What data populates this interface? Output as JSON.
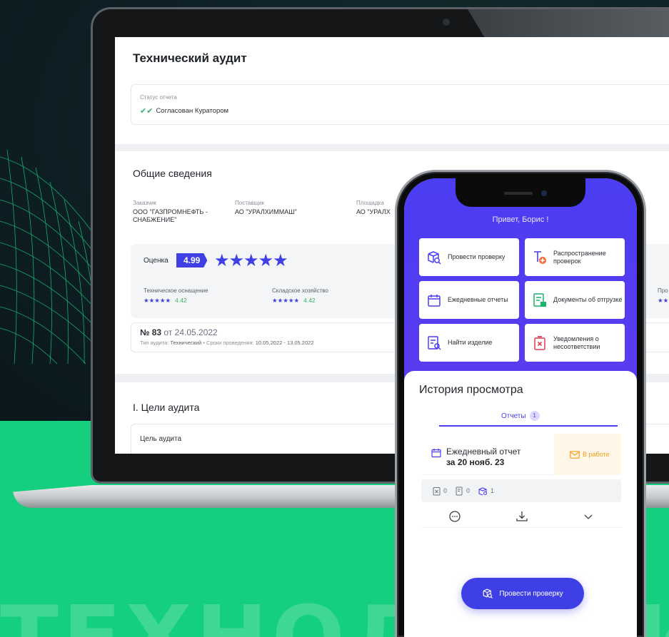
{
  "laptop": {
    "page_title": "Технический аудит",
    "status": {
      "label": "Статус отчета",
      "value": "Согласован Куратором"
    },
    "general": {
      "title": "Общие сведения",
      "customer": {
        "label": "Заказчик",
        "value": "ООО \"ГАЗПРОМНЕФТЬ - СНАБЖЕНИЕ\""
      },
      "supplier": {
        "label": "Поставщик",
        "value": "АО \"УРАЛХИММАШ\""
      },
      "site": {
        "label": "Площадка",
        "value": "АО \"УРАЛХ"
      }
    },
    "rating": {
      "label": "Оценка",
      "score": "4.99",
      "stars": "★★★★★",
      "sub": [
        {
          "label": "Техническое оснащение",
          "stars": "★★★★★",
          "value": "4.42"
        },
        {
          "label": "Складское хозяйство",
          "stars": "★★★★★",
          "value": "4.42"
        },
        {
          "label": "Про",
          "stars": "★★",
          "value": ""
        }
      ]
    },
    "audit": {
      "number": "№ 83",
      "date": "от 24.05.2022",
      "type_label": "Тип аудита:",
      "type_value": "Технический",
      "period_label": "• Сроки проведения:",
      "period_value": "10.05.2022 - 13.05.2022"
    },
    "goals": {
      "title": "I. Цели аудита",
      "goal_label": "Цель аудита"
    }
  },
  "phone": {
    "greeting": "Привет, Борис !",
    "tiles": [
      {
        "label": "Провести проверку",
        "icon": "box-search-icon"
      },
      {
        "label": "Распространение проверок",
        "icon": "document-plus-icon"
      },
      {
        "label": "Ежедневные отчеты",
        "icon": "calendar-icon"
      },
      {
        "label": "Документы об отгрузке",
        "icon": "shipping-doc-icon"
      },
      {
        "label": "Найти изделие",
        "icon": "find-doc-icon"
      },
      {
        "label": "Уведомления о несоответствии",
        "icon": "nonconformity-icon"
      }
    ],
    "history": {
      "title": "История просмотра",
      "tab_label": "Отчеты",
      "tab_count": "1",
      "report": {
        "type": "Ежедневный отчет",
        "date": "за 20 нояб. 23",
        "status": "В работе"
      },
      "counts": [
        "0",
        "0",
        "1"
      ]
    },
    "fab_label": "Провести проверку"
  },
  "background_text": "ТЕХНОЛОГИИ",
  "colors": {
    "accent": "#3f3fe6",
    "phone_header": "#4a3df2",
    "green": "#14cf7d",
    "status_ok": "#35b36b",
    "status_in_progress": "#f0a01c"
  }
}
